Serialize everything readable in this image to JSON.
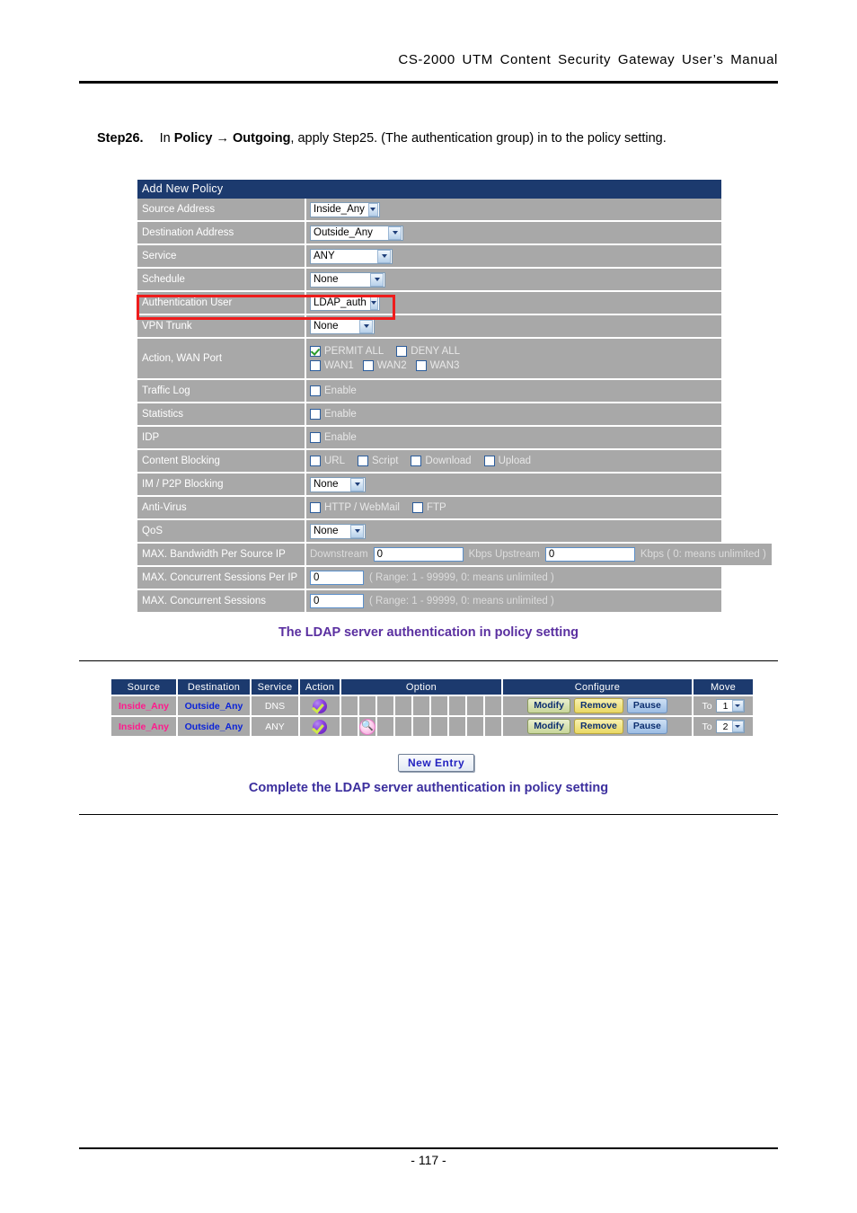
{
  "document": {
    "header_title": "CS-2000 UTM Content Security Gateway User’s Manual",
    "page_number": "- 117 -"
  },
  "step": {
    "number": "Step26.",
    "text_1": "In ",
    "bold_1": "Policy",
    "arrow": "→",
    "bold_2": "Outgoing",
    "text_2": ", apply Step25. (The authentication group) in to the policy setting."
  },
  "form": {
    "title": "Add New Policy",
    "rows": [
      {
        "label": "Source Address",
        "value": "Inside_Any"
      },
      {
        "label": "Destination Address",
        "value": "Outside_Any"
      },
      {
        "label": "Service",
        "value": "ANY"
      },
      {
        "label": "Schedule",
        "value": "None"
      },
      {
        "label": "Authentication User",
        "value": "LDAP_auth"
      },
      {
        "label": "VPN Trunk",
        "value": "None"
      },
      {
        "label": "Action, WAN Port"
      },
      {
        "label": "Traffic Log",
        "value": "Enable"
      },
      {
        "label": "Statistics",
        "value": "Enable"
      },
      {
        "label": "IDP",
        "value": "Enable"
      },
      {
        "label": "Content Blocking"
      },
      {
        "label": "IM / P2P Blocking",
        "value": "None"
      },
      {
        "label": "Anti-Virus"
      },
      {
        "label": "QoS",
        "value": "None"
      },
      {
        "label": "MAX. Bandwidth Per Source IP"
      },
      {
        "label": "MAX. Concurrent Sessions Per IP"
      },
      {
        "label": "MAX. Concurrent Sessions"
      }
    ],
    "action": {
      "permit_all": "PERMIT ALL",
      "deny_all": "DENY ALL",
      "wan1": "WAN1",
      "wan2": "WAN2",
      "wan3": "WAN3"
    },
    "content_blocking": {
      "url": "URL",
      "script": "Script",
      "download": "Download",
      "upload": "Upload"
    },
    "antivirus": {
      "http_webmail": "HTTP / WebMail",
      "ftp": "FTP"
    },
    "bandwidth": {
      "downstream_label": "Downstream",
      "downstream_value": "0",
      "kbps_upstream_label": "Kbps Upstream",
      "upstream_value": "0",
      "kbps_note": "Kbps ( 0: means unlimited )"
    },
    "sessions_per_ip": {
      "value": "0",
      "note": "( Range: 1 - 99999, 0: means unlimited )"
    },
    "sessions": {
      "value": "0",
      "note": "( Range: 1 - 99999, 0: means unlimited )"
    }
  },
  "caption_1": "The LDAP server authentication in policy setting",
  "caption_2": "Complete the LDAP server authentication in policy setting",
  "policy_list": {
    "headers": [
      "Source",
      "Destination",
      "Service",
      "Action",
      "Option",
      "Configure",
      "Move"
    ],
    "rows": [
      {
        "source": "Inside_Any",
        "destination": "Outside_Any",
        "service": "DNS",
        "action_icon": "permit-ball-icon",
        "option_icon": "",
        "modify": "Modify",
        "remove": "Remove",
        "pause": "Pause",
        "to_label": "To",
        "move_value": "1"
      },
      {
        "source": "Inside_Any",
        "destination": "Outside_Any",
        "service": "ANY",
        "action_icon": "permit-ball-icon",
        "option_icon": "authentication-icon",
        "modify": "Modify",
        "remove": "Remove",
        "pause": "Pause",
        "to_label": "To",
        "move_value": "2"
      }
    ]
  },
  "new_entry_button": "New Entry",
  "colors": {
    "table_header": "#1c3a6e",
    "row_bg": "#a8a8a8",
    "highlight": "#ee1c1c",
    "caption": "#5a2fa0",
    "source_text": "#ff1a8c",
    "destination_text": "#0b23d8"
  }
}
